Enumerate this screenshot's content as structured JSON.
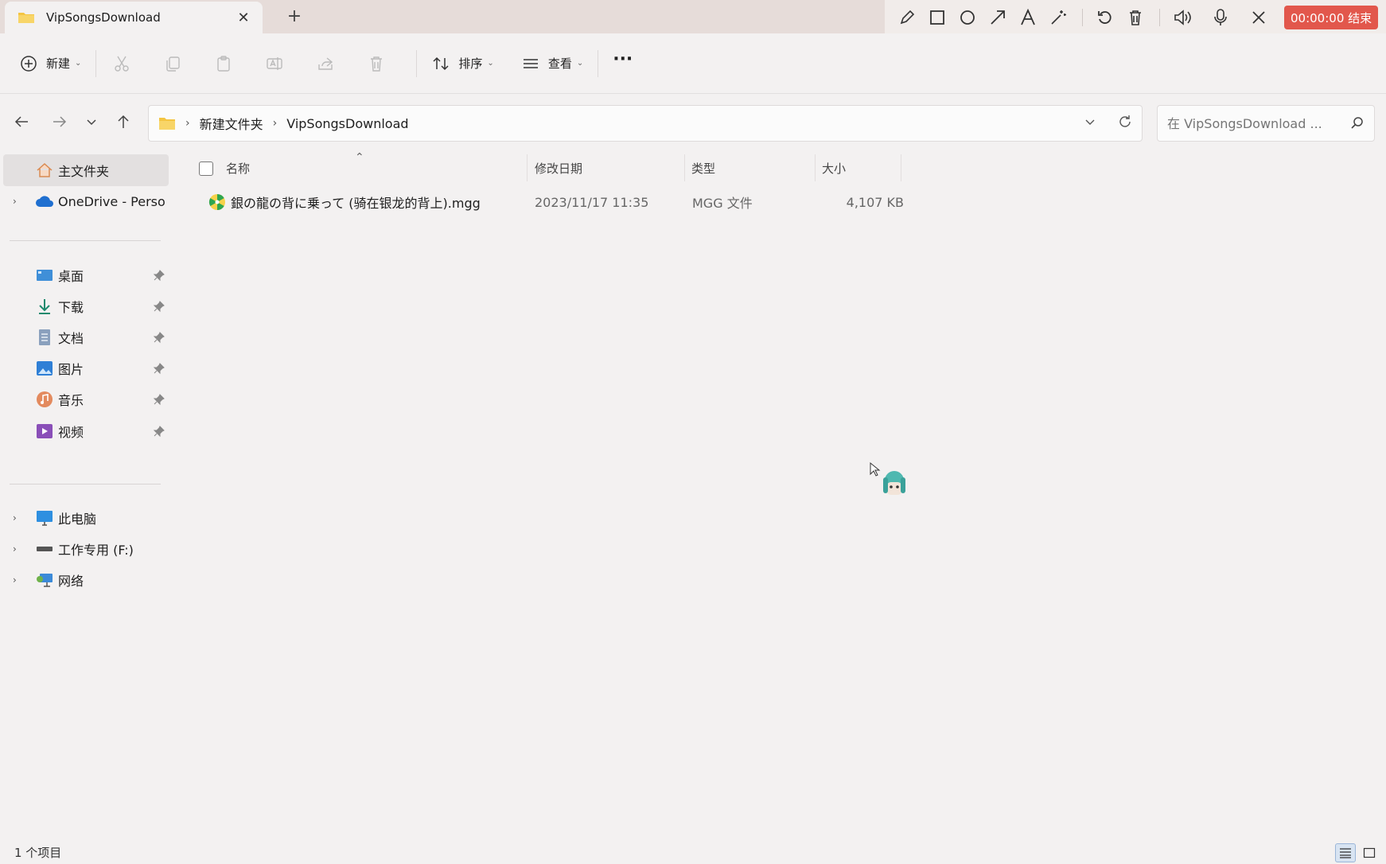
{
  "tab": {
    "title": "VipSongsDownload",
    "close": "✕",
    "new_tab": "+"
  },
  "recorder": {
    "timer_label": "00:00:00 结束"
  },
  "toolbar": {
    "new_label": "新建",
    "sort_label": "排序",
    "view_label": "查看",
    "more_label": "···"
  },
  "address": {
    "segments": [
      "新建文件夹",
      "VipSongsDownload"
    ]
  },
  "search": {
    "placeholder": "在 VipSongsDownload ..."
  },
  "sidebar": {
    "home": "主文件夹",
    "onedrive": "OneDrive - Perso",
    "quick": [
      {
        "label": "桌面"
      },
      {
        "label": "下载"
      },
      {
        "label": "文档"
      },
      {
        "label": "图片"
      },
      {
        "label": "音乐"
      },
      {
        "label": "视频"
      }
    ],
    "this_pc": "此电脑",
    "drive_f": "工作专用 (F:)",
    "network": "网络"
  },
  "columns": {
    "name": "名称",
    "date": "修改日期",
    "type": "类型",
    "size": "大小"
  },
  "files": [
    {
      "name": "銀の龍の背に乗って (骑在银龙的背上).mgg",
      "date": "2023/11/17 11:35",
      "type": "MGG 文件",
      "size": "4,107 KB"
    }
  ],
  "status": {
    "count": "1 个项目"
  },
  "colors": {
    "accent": "#0067c0",
    "record": "#e2574c",
    "folder": "#f4c542"
  }
}
